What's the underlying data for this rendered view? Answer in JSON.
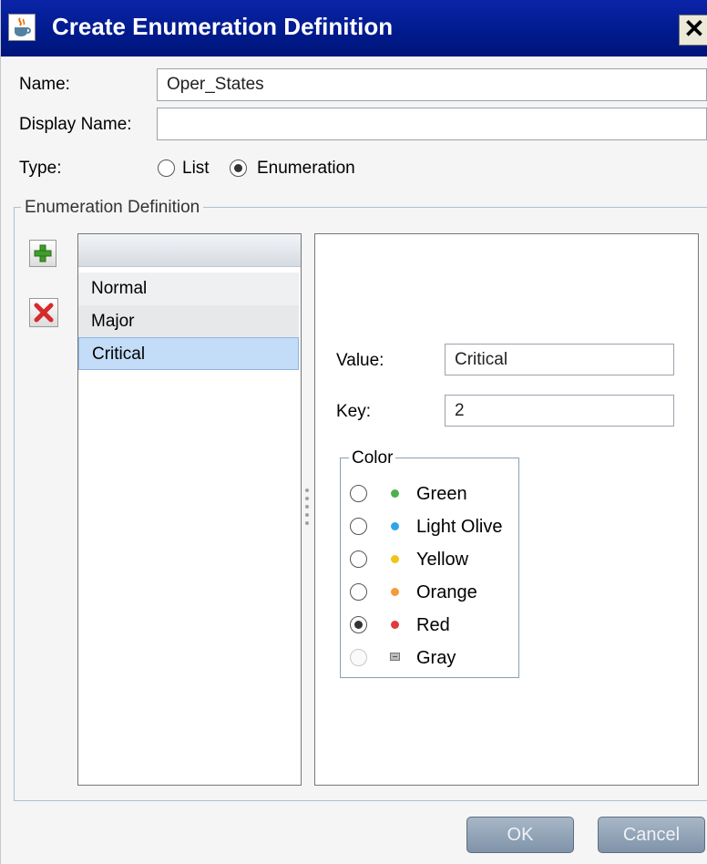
{
  "window": {
    "title": "Create Enumeration Definition",
    "close_glyph": "✕"
  },
  "form": {
    "name_label": "Name:",
    "name_value": "Oper_States",
    "display_name_label": "Display Name:",
    "display_name_value": "",
    "type_label": "Type:",
    "type_options": [
      {
        "label": "List",
        "selected": false
      },
      {
        "label": "Enumeration",
        "selected": true
      }
    ]
  },
  "enumeration": {
    "group_title": "Enumeration Definition",
    "add_icon": "add-icon",
    "delete_icon": "delete-icon",
    "items": [
      {
        "label": "Normal",
        "selected": false
      },
      {
        "label": "Major",
        "selected": false
      },
      {
        "label": "Critical",
        "selected": true
      }
    ]
  },
  "detail": {
    "value_label": "Value:",
    "value": "Critical",
    "key_label": "Key:",
    "key": "2",
    "color_group_title": "Color",
    "colors": [
      {
        "label": "Green",
        "hex": "#4caf50",
        "selected": false,
        "enabled": true
      },
      {
        "label": "Light Olive",
        "hex": "#2ea7e8",
        "selected": false,
        "enabled": true
      },
      {
        "label": "Yellow",
        "hex": "#f0c419",
        "selected": false,
        "enabled": true
      },
      {
        "label": "Orange",
        "hex": "#f29d38",
        "selected": false,
        "enabled": true
      },
      {
        "label": "Red",
        "hex": "#e0393e",
        "selected": true,
        "enabled": true
      },
      {
        "label": "Gray",
        "hex": "#9e9e9e",
        "selected": false,
        "enabled": false
      }
    ]
  },
  "buttons": {
    "ok": "OK",
    "cancel": "Cancel"
  }
}
